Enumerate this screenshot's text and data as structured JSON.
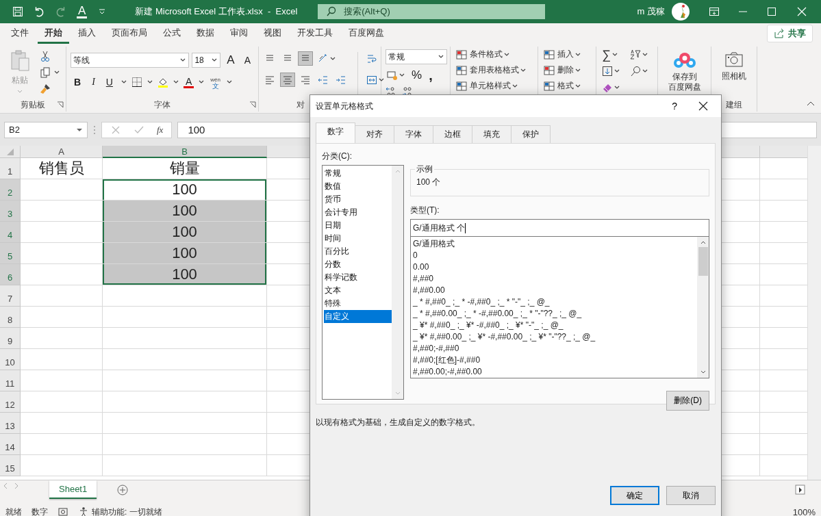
{
  "title_bar": {
    "qat_font_color": "A",
    "title": "新建 Microsoft Excel 工作表.xlsx  -  Excel",
    "search": "搜索(Alt+Q)",
    "user": "m 茂稼"
  },
  "menu_tabs": [
    {
      "label": "文件",
      "selected": false
    },
    {
      "label": "开始",
      "selected": true
    },
    {
      "label": "插入",
      "selected": false
    },
    {
      "label": "页面布局",
      "selected": false
    },
    {
      "label": "公式",
      "selected": false
    },
    {
      "label": "数据",
      "selected": false
    },
    {
      "label": "审阅",
      "selected": false
    },
    {
      "label": "视图",
      "selected": false
    },
    {
      "label": "开发工具",
      "selected": false
    },
    {
      "label": "百度网盘",
      "selected": false
    }
  ],
  "share_button": "共享",
  "ribbon": {
    "clipboard": {
      "paste": "粘贴",
      "label": "剪贴板"
    },
    "font": {
      "font_name": "等线",
      "font_size": "18",
      "grow": "A",
      "shrink": "A",
      "bold": "B",
      "italic": "I",
      "underline": "U",
      "font_color": "A",
      "phonetic": "wén",
      "phonetic_char": "文",
      "label": "字体"
    },
    "alignment": {
      "label": "对"
    },
    "number": {
      "format": "常规",
      "percent": "%",
      "comma": ","
    },
    "styles": [
      "条件格式",
      "套用表格格式",
      "单元格样式"
    ],
    "cells": [
      "插入",
      "删除",
      "格式"
    ],
    "editing": {
      "sum": "∑"
    },
    "baidu": {
      "line1": "保存到",
      "line2": "百度网盘"
    },
    "camera": "照相机",
    "new_group_label": "建组"
  },
  "formula_bar": {
    "name_box": "B2",
    "fx": "fx",
    "value": "100"
  },
  "sheet": {
    "columns": [
      {
        "label": "A",
        "selected": false
      },
      {
        "label": "B",
        "selected": true
      }
    ],
    "rows": [
      {
        "number": "1",
        "selected": false,
        "a": "销售员",
        "b": "销量",
        "b_selected": false,
        "active": false
      },
      {
        "number": "2",
        "selected": true,
        "b": "100",
        "b_selected": true,
        "active": true
      },
      {
        "number": "3",
        "selected": true,
        "b": "100",
        "b_selected": true,
        "active": false
      },
      {
        "number": "4",
        "selected": true,
        "b": "100",
        "b_selected": true,
        "active": false
      },
      {
        "number": "5",
        "selected": true,
        "b": "100",
        "b_selected": true,
        "active": false
      },
      {
        "number": "6",
        "selected": true,
        "b": "100",
        "b_selected": true,
        "active": false
      },
      {
        "number": "7",
        "selected": false
      },
      {
        "number": "8",
        "selected": false
      },
      {
        "number": "9",
        "selected": false
      },
      {
        "number": "10",
        "selected": false
      },
      {
        "number": "11",
        "selected": false
      },
      {
        "number": "12",
        "selected": false
      },
      {
        "number": "13",
        "selected": false
      },
      {
        "number": "14",
        "selected": false
      },
      {
        "number": "15",
        "selected": false
      }
    ]
  },
  "sheet_tabs": [
    {
      "label": "Sheet1",
      "selected": true
    }
  ],
  "status_bar": {
    "mode": "就绪",
    "numeric": "数字",
    "accessibility": "辅助功能: 一切就绪",
    "zoom": "100%"
  },
  "dialog": {
    "title": "设置单元格格式",
    "help": "?",
    "tabs": [
      {
        "label": "数字",
        "selected": true
      },
      {
        "label": "对齐",
        "selected": false
      },
      {
        "label": "字体",
        "selected": false
      },
      {
        "label": "边框",
        "selected": false
      },
      {
        "label": "填充",
        "selected": false
      },
      {
        "label": "保护",
        "selected": false
      }
    ],
    "category_label": "分类(C):",
    "categories": [
      {
        "label": "常规",
        "selected": false
      },
      {
        "label": "数值",
        "selected": false
      },
      {
        "label": "货币",
        "selected": false
      },
      {
        "label": "会计专用",
        "selected": false
      },
      {
        "label": "日期",
        "selected": false
      },
      {
        "label": "时间",
        "selected": false
      },
      {
        "label": "百分比",
        "selected": false
      },
      {
        "label": "分数",
        "selected": false
      },
      {
        "label": "科学记数",
        "selected": false
      },
      {
        "label": "文本",
        "selected": false
      },
      {
        "label": "特殊",
        "selected": false
      },
      {
        "label": "自定义",
        "selected": true
      }
    ],
    "sample_label": "示例",
    "sample": "100 个",
    "type_label": "类型(T):",
    "type_value": "G/通用格式 个",
    "formats": [
      "G/通用格式",
      "0",
      "0.00",
      "#,##0",
      "#,##0.00",
      "_ * #,##0_ ;_ * -#,##0_ ;_ * \"-\"_ ;_ @_",
      "_ * #,##0.00_ ;_ * -#,##0.00_ ;_ * \"-\"??_ ;_ @_",
      "_ ¥* #,##0_ ;_ ¥* -#,##0_ ;_ ¥* \"-\"_ ;_ @_",
      "_ ¥* #,##0.00_ ;_ ¥* -#,##0.00_ ;_ ¥* \"-\"??_ ;_ @_",
      "#,##0;-#,##0",
      "#,##0;[红色]-#,##0",
      "#,##0.00;-#,##0.00"
    ],
    "delete_button": "删除(D)",
    "description": "以现有格式为基础，生成自定义的数字格式。",
    "ok_button": "确定",
    "cancel_button": "取消"
  }
}
